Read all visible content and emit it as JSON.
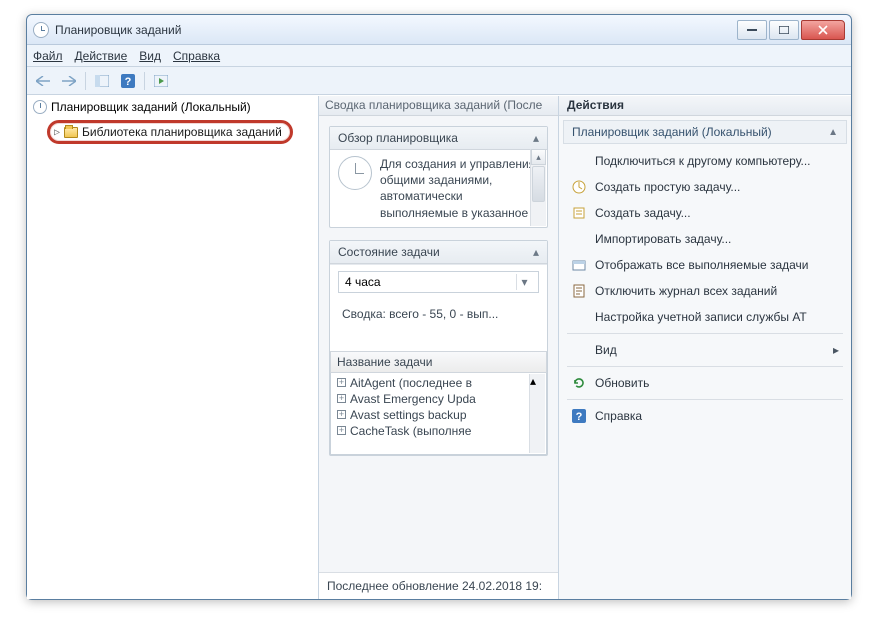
{
  "window": {
    "title": "Планировщик заданий"
  },
  "menu": {
    "file": "Файл",
    "action": "Действие",
    "view": "Вид",
    "help": "Справка"
  },
  "tree": {
    "root": "Планировщик заданий (Локальный)",
    "library": "Библиотека планировщика заданий"
  },
  "summary": {
    "header": "Сводка планировщика заданий (После",
    "overview_title": "Обзор планировщика",
    "overview_text": "Для создания и управления общими заданиями, автоматически выполняемые в указанное",
    "status_title": "Состояние задачи",
    "period": "4 часа",
    "summary_line": "Сводка: всего - 55, 0 - вып...",
    "tasklist_header": "Название задачи",
    "tasks": [
      "AitAgent (последнее в",
      "Avast Emergency Upda",
      "Avast settings backup",
      "CacheTask (выполняе"
    ],
    "lastupdate": "Последнее обновление 24.02.2018 19:"
  },
  "actions": {
    "header": "Действия",
    "subheader": "Планировщик заданий (Локальный)",
    "items": {
      "connect": "Подключиться к другому компьютеру...",
      "create_basic": "Создать простую задачу...",
      "create_task": "Создать задачу...",
      "import_task": "Импортировать задачу...",
      "show_running": "Отображать все выполняемые задачи",
      "disable_log": "Отключить журнал всех заданий",
      "at_service": "Настройка учетной записи службы AT",
      "view": "Вид",
      "refresh": "Обновить",
      "help": "Справка"
    }
  }
}
